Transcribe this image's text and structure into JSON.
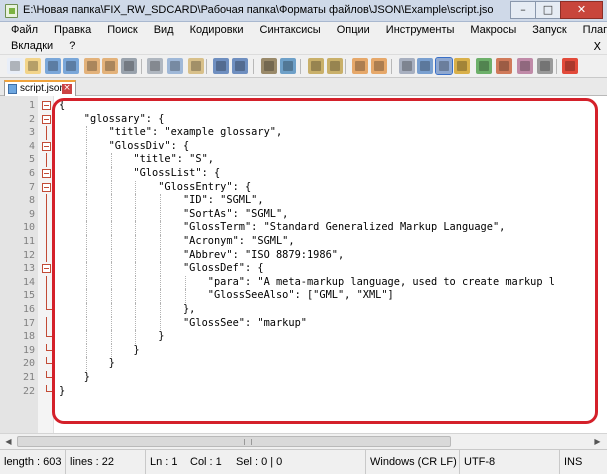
{
  "window": {
    "title": "E:\\Новая папка\\FIX_RW_SDCARD\\Рабочая папка\\Форматы файлов\\JSON\\Example\\script.json - Notepad+...",
    "min_glyph": "–",
    "max_glyph": "□",
    "close_glyph": "✕"
  },
  "menu": {
    "row1": [
      "Файл",
      "Правка",
      "Поиск",
      "Вид",
      "Кодировки",
      "Синтаксисы",
      "Опции",
      "Инструменты",
      "Макросы",
      "Запуск",
      "Плагины"
    ],
    "row2": [
      "Вкладки",
      "?"
    ],
    "close_glyph": "X"
  },
  "toolbar": {
    "icons": [
      "new-file-icon",
      "open-file-icon",
      "save-icon",
      "save-all-icon",
      "close-icon",
      "close-all-icon",
      "print-icon",
      "cut-icon",
      "copy-icon",
      "paste-icon",
      "undo-icon",
      "redo-icon",
      "find-icon",
      "replace-icon",
      "zoom-in-icon",
      "zoom-out-icon",
      "sync-vertical-icon",
      "sync-horizontal-icon",
      "word-wrap-icon",
      "show-all-characters-icon",
      "indent-guide-icon",
      "user-language-icon",
      "document-map-icon",
      "function-list-icon",
      "folder-workspace-icon",
      "monitoring-icon",
      "record-macro-icon"
    ]
  },
  "tab": {
    "label": "script.json",
    "close_glyph": "×"
  },
  "editor": {
    "lines": [
      {
        "n": "1",
        "text": "{",
        "fold": "open"
      },
      {
        "n": "2",
        "text": "    \"glossary\": {",
        "fold": "open"
      },
      {
        "n": "3",
        "text": "        \"title\": \"example glossary\",",
        "fold": "line"
      },
      {
        "n": "4",
        "text": "        \"GlossDiv\": {",
        "fold": "open"
      },
      {
        "n": "5",
        "text": "            \"title\": \"S\",",
        "fold": "line"
      },
      {
        "n": "6",
        "text": "            \"GlossList\": {",
        "fold": "open"
      },
      {
        "n": "7",
        "text": "                \"GlossEntry\": {",
        "fold": "open"
      },
      {
        "n": "8",
        "text": "                    \"ID\": \"SGML\",",
        "fold": "line"
      },
      {
        "n": "9",
        "text": "                    \"SortAs\": \"SGML\",",
        "fold": "line"
      },
      {
        "n": "10",
        "text": "                    \"GlossTerm\": \"Standard Generalized Markup Language\",",
        "fold": "line"
      },
      {
        "n": "11",
        "text": "                    \"Acronym\": \"SGML\",",
        "fold": "line"
      },
      {
        "n": "12",
        "text": "                    \"Abbrev\": \"ISO 8879:1986\",",
        "fold": "line"
      },
      {
        "n": "13",
        "text": "                    \"GlossDef\": {",
        "fold": "open"
      },
      {
        "n": "14",
        "text": "                        \"para\": \"A meta-markup language, used to create markup l",
        "fold": "line"
      },
      {
        "n": "15",
        "text": "                        \"GlossSeeAlso\": [\"GML\", \"XML\"]",
        "fold": "line"
      },
      {
        "n": "16",
        "text": "                    },",
        "fold": "end"
      },
      {
        "n": "17",
        "text": "                    \"GlossSee\": \"markup\"",
        "fold": "line"
      },
      {
        "n": "18",
        "text": "                }",
        "fold": "end"
      },
      {
        "n": "19",
        "text": "            }",
        "fold": "end"
      },
      {
        "n": "20",
        "text": "        }",
        "fold": "end"
      },
      {
        "n": "21",
        "text": "    }",
        "fold": "end"
      },
      {
        "n": "22",
        "text": "}",
        "fold": "end"
      }
    ]
  },
  "scrollbar": {
    "left_glyph": "◀",
    "right_glyph": "▶"
  },
  "status": {
    "length": "length : 603",
    "lines": "lines : 22",
    "ln": "Ln : 1",
    "col": "Col : 1",
    "sel": "Sel : 0 | 0",
    "eol": "Windows (CR LF)",
    "encoding": "UTF-8",
    "mode": "INS"
  }
}
